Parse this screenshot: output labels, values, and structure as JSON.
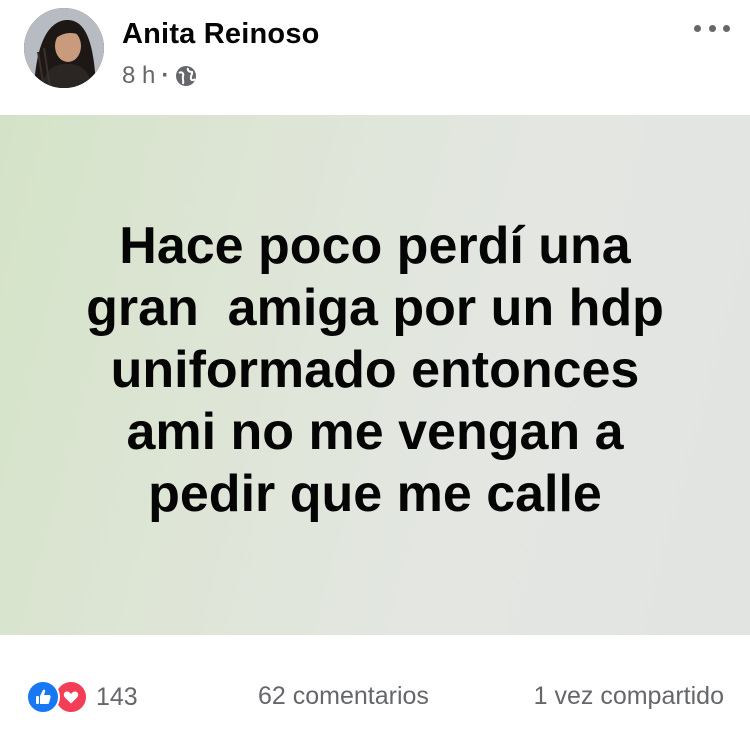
{
  "post": {
    "author": "Anita Reinoso",
    "time": "8 h",
    "separator": "·",
    "audience_icon": "globe-icon",
    "menu_icon": "more-options-icon",
    "status_text": "Hace poco perdí una\ngran  amiga por un hdp\nuniformado entonces\nami no me vengan a\npedir que me calle",
    "status_background": [
      "#d4e3c7",
      "#e2e4e2"
    ]
  },
  "footer": {
    "reaction_icons": [
      "like-icon",
      "love-icon"
    ],
    "reaction_count": "143",
    "comments": "62 comentarios",
    "shares": "1 vez compartido"
  },
  "colors": {
    "like": "#1877f2",
    "love": "#f33e58",
    "secondary_text": "#65676b",
    "primary_text": "#050505"
  }
}
